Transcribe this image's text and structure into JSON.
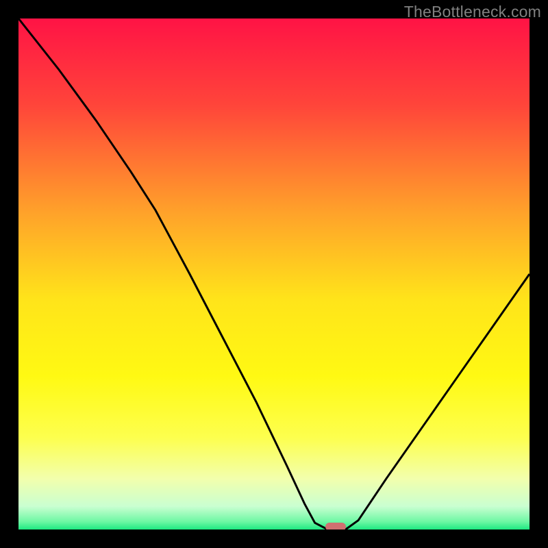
{
  "watermark": "TheBottleneck.com",
  "chart_data": {
    "type": "line",
    "title": "",
    "xlabel": "",
    "ylabel": "",
    "xlim": [
      0,
      100
    ],
    "ylim": [
      0,
      100
    ],
    "gradient_stops": [
      {
        "offset": 0,
        "color": "#ff1345"
      },
      {
        "offset": 0.17,
        "color": "#ff453a"
      },
      {
        "offset": 0.38,
        "color": "#ffa22a"
      },
      {
        "offset": 0.55,
        "color": "#ffe41a"
      },
      {
        "offset": 0.7,
        "color": "#fff913"
      },
      {
        "offset": 0.82,
        "color": "#fdff4e"
      },
      {
        "offset": 0.9,
        "color": "#f2ffac"
      },
      {
        "offset": 0.955,
        "color": "#c9ffd1"
      },
      {
        "offset": 0.985,
        "color": "#6cf7a3"
      },
      {
        "offset": 1.0,
        "color": "#1de981"
      }
    ],
    "series": [
      {
        "name": "bottleneck-curve",
        "points": [
          {
            "x": 0.0,
            "y": 100.0
          },
          {
            "x": 7.9,
            "y": 90.0
          },
          {
            "x": 15.2,
            "y": 80.0
          },
          {
            "x": 22.0,
            "y": 70.0
          },
          {
            "x": 26.8,
            "y": 62.5
          },
          {
            "x": 33.5,
            "y": 50.0
          },
          {
            "x": 40.0,
            "y": 37.5
          },
          {
            "x": 46.5,
            "y": 25.0
          },
          {
            "x": 52.5,
            "y": 12.5
          },
          {
            "x": 56.0,
            "y": 5.0
          },
          {
            "x": 58.0,
            "y": 1.3
          },
          {
            "x": 60.5,
            "y": 0.0
          },
          {
            "x": 64.0,
            "y": 0.0
          },
          {
            "x": 66.5,
            "y": 1.8
          },
          {
            "x": 72.0,
            "y": 10.0
          },
          {
            "x": 79.0,
            "y": 20.0
          },
          {
            "x": 86.0,
            "y": 30.0
          },
          {
            "x": 93.0,
            "y": 40.0
          },
          {
            "x": 100.0,
            "y": 50.0
          }
        ]
      }
    ],
    "marker": {
      "x": 62.0,
      "y": 0.5,
      "color": "#d07070"
    }
  }
}
